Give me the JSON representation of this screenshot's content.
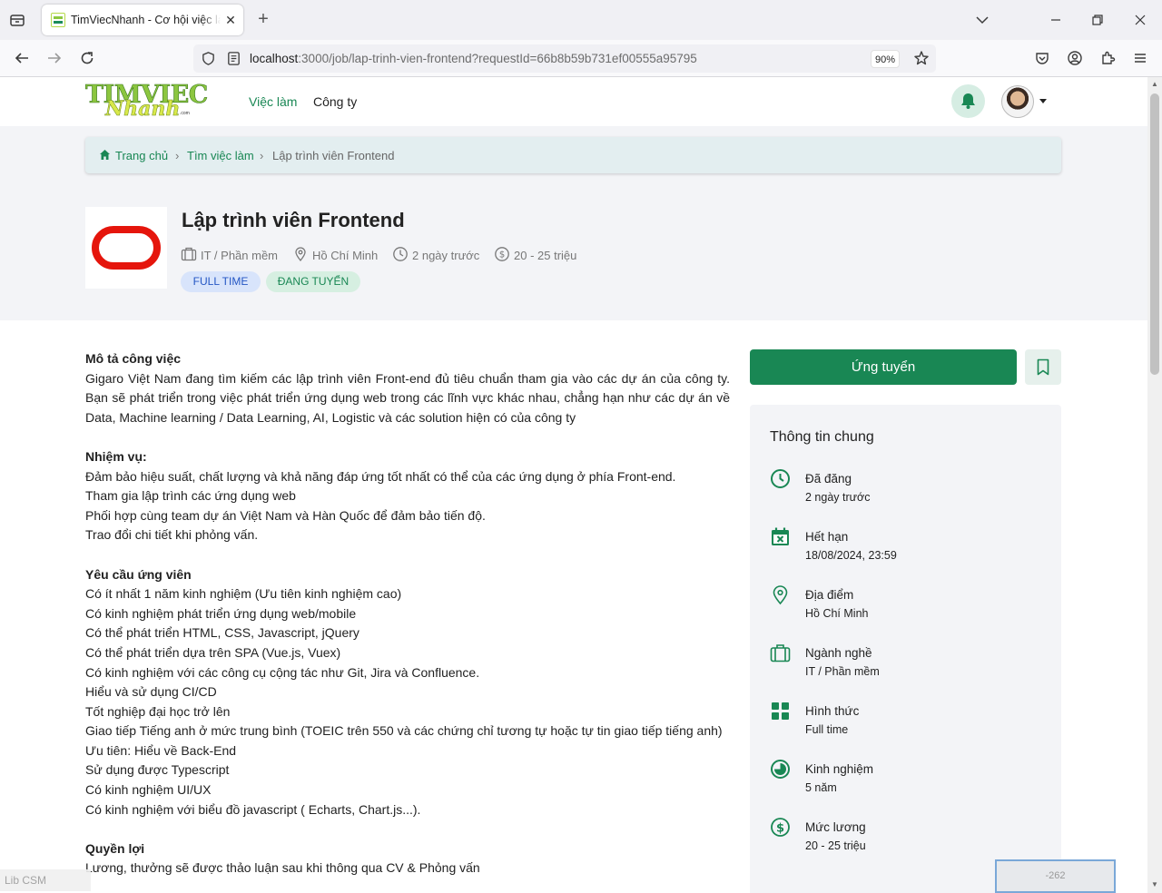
{
  "browser": {
    "tab_title": "TimViecNhanh - Cơ hội việc làm",
    "url_host": "localhost",
    "url_rest": ":3000/job/lap-trinh-vien-frontend?requestId=66b8b59b731ef00555a95795",
    "zoom": "90%"
  },
  "site": {
    "logo_top": "TIMVIEC",
    "logo_bottom": "Nhanh",
    "logo_com": ".com",
    "nav": [
      "Việc làm",
      "Công ty"
    ]
  },
  "breadcrumb": [
    "Trang chủ",
    "Tìm việc làm",
    "Lập trình viên Frontend"
  ],
  "job": {
    "title": "Lập trình viên Frontend",
    "industry": "IT / Phần mềm",
    "location": "Hồ Chí Minh",
    "posted": "2 ngày trước",
    "salary": "20 - 25 triệu",
    "badge_type": "FULL TIME",
    "badge_status": "ĐANG TUYỂN"
  },
  "description": {
    "s1_title": "Mô tả công việc",
    "s1_text": "Gigaro Việt Nam đang tìm kiếm các lập trình viên Front-end đủ tiêu chuẩn tham gia vào các dự án của công ty. Bạn sẽ phát triển trong việc phát triển ứng dụng web trong các lĩnh vực khác nhau, chẳng hạn như các dự án về Data, Machine learning / Data Learning, AI, Logistic và các solution hiện có của công ty",
    "s2_title": "Nhiệm vụ:",
    "s2_lines": [
      "Đảm bảo hiệu suất, chất lượng và khả năng đáp ứng tốt nhất có thể của các ứng dụng ở phía Front-end.",
      "Tham gia lập trình các ứng dụng web",
      "Phối hợp cùng team dự án Việt Nam và Hàn Quốc để đảm bảo tiến độ.",
      "Trao đổi chi tiết khi phỏng vấn."
    ],
    "s3_title": "Yêu cầu ứng viên",
    "s3_lines": [
      "Có ít nhất 1 năm kinh nghiệm (Ưu tiên kinh nghiệm cao)",
      "Có kinh nghiệm phát triển ứng dụng web/mobile",
      "Có thể phát triển HTML, CSS, Javascript, jQuery",
      "Có thể phát triển dựa trên SPA (Vue.js, Vuex)",
      "Có kinh nghiệm với các công cụ cộng tác như Git, Jira và Confluence.",
      "Hiểu và sử dụng CI/CD",
      "Tốt nghiệp đại học trở lên",
      "Giao tiếp Tiếng anh ở mức trung bình (TOEIC trên 550 và các chứng chỉ tương tự hoặc tự tin giao tiếp tiếng anh)",
      "Ưu tiên: Hiểu về Back-End",
      "Sử dụng được Typescript",
      "Có kinh nghiệm UI/UX",
      "Có kinh nghiệm với biểu đồ javascript ( Echarts, Chart.js...)."
    ],
    "s4_title": "Quyền lợi",
    "s4_lines": [
      "Lương, thưởng sẽ được thảo luận sau khi thông qua CV & Phỏng vấn"
    ]
  },
  "actions": {
    "apply": "Ứng tuyển"
  },
  "info": {
    "title": "Thông tin chung",
    "items": [
      {
        "label": "Đã đăng",
        "value": "2 ngày trước",
        "icon": "clock-icon"
      },
      {
        "label": "Hết hạn",
        "value": "18/08/2024, 23:59",
        "icon": "calendar-x-icon"
      },
      {
        "label": "Địa điểm",
        "value": "Hồ Chí Minh",
        "icon": "location-pin-icon"
      },
      {
        "label": "Ngành nghề",
        "value": "IT / Phần mềm",
        "icon": "briefcase-icon"
      },
      {
        "label": "Hình thức",
        "value": "Full time",
        "icon": "grid-icon"
      },
      {
        "label": "Kinh nghiệm",
        "value": "5 năm",
        "icon": "pie-clock-icon"
      },
      {
        "label": "Mức lương",
        "value": "20 - 25 triệu",
        "icon": "dollar-icon"
      }
    ]
  },
  "overlay": {
    "lib_label": "Lib CSM",
    "box_value": "-262"
  },
  "colors": {
    "accent": "#198754",
    "header_bg": "#f3f4f7",
    "logo_red": "#e5150c"
  }
}
